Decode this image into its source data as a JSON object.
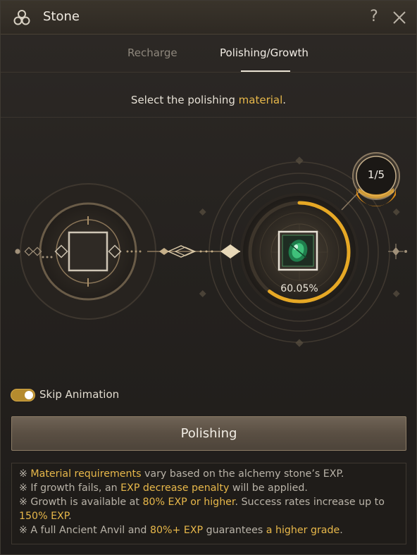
{
  "window": {
    "title": "Stone",
    "help_label": "?",
    "title_icon": "triskele-icon"
  },
  "tabs": [
    {
      "label": "Recharge",
      "active": false
    },
    {
      "label": "Polishing/Growth",
      "active": true
    }
  ],
  "instruction": {
    "prefix": "Select the polishing ",
    "highlight": "material",
    "suffix": "."
  },
  "stone": {
    "count": "1/5",
    "exp_percent": "60.05%",
    "exp_fraction": 0.6005,
    "icon": "green-gem-icon"
  },
  "skip_animation": {
    "label": "Skip Animation",
    "enabled": true
  },
  "primary_button": {
    "label": "Polishing"
  },
  "notes": [
    {
      "mark": "※ ",
      "hl1": "Material requirements",
      "t1": " vary based on the alchemy stone’s EXP.",
      "hl2": "",
      "t2": "",
      "hl3": "",
      "t3": ""
    },
    {
      "mark": "※ ",
      "t0": "If growth fails, an ",
      "hl1": "EXP decrease penalty",
      "t1": " will be applied.",
      "hl2": "",
      "t2": "",
      "hl3": "",
      "t3": ""
    },
    {
      "mark": "※ ",
      "t0": "Growth is available at ",
      "hl1": "80% EXP or higher",
      "t1": ". Success rates increase up to ",
      "hl2": "150% EXP",
      "t2": ".",
      "hl3": "",
      "t3": ""
    },
    {
      "mark": "※ ",
      "t0": "A full Ancient Anvil and ",
      "hl1": "80%+ EXP",
      "t1": " guarantees ",
      "hl2": "a higher grade",
      "t2": ".",
      "hl3": "",
      "t3": ""
    }
  ],
  "colors": {
    "accent": "#e8b84a",
    "text": "#e8e2d6",
    "muted": "#8e877c",
    "frame": "#b79663"
  }
}
